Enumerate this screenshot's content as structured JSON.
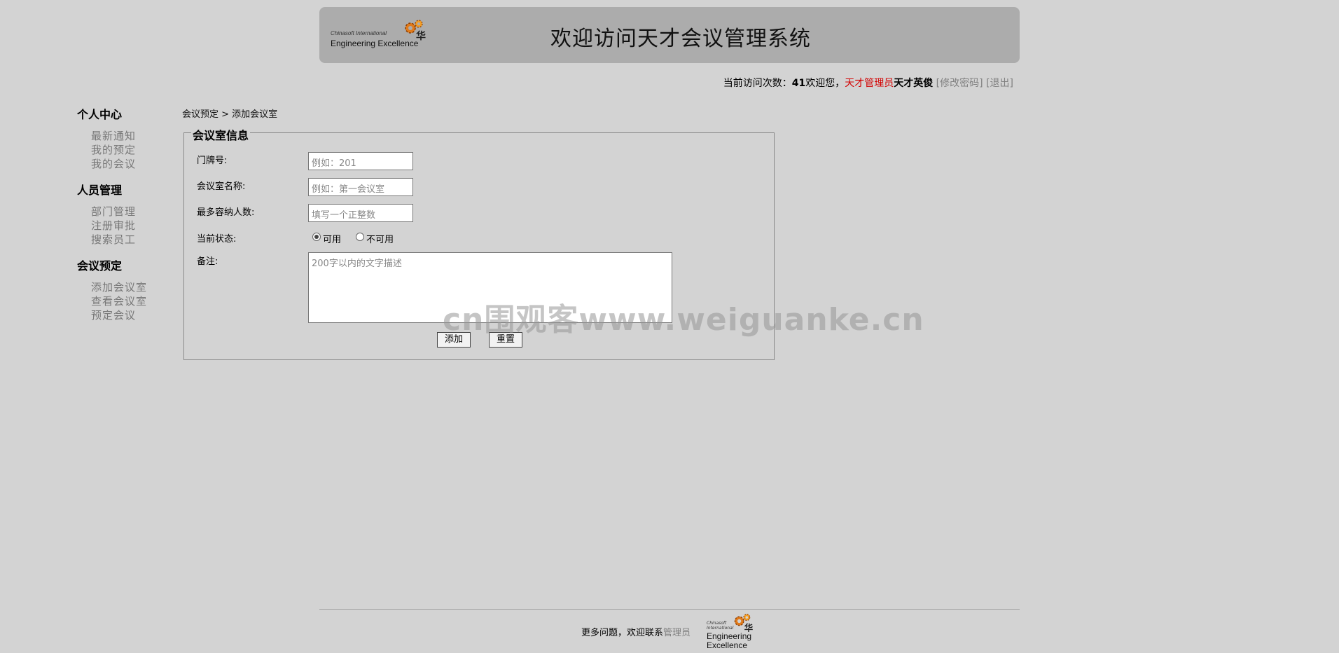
{
  "header": {
    "logo_line1": "Chinasoft International",
    "logo_line2": "Engineering Excellence",
    "title": "欢迎访问天才会议管理系统"
  },
  "userbar": {
    "visits_label": "当前访问次数：",
    "visits_count": "41",
    "welcome": "欢迎您，",
    "role": "天才管理员",
    "username": "天才英俊",
    "change_password": "[修改密码]",
    "logout": "[退出]"
  },
  "sidebar": {
    "groups": [
      {
        "title": "个人中心",
        "items": [
          "最新通知",
          "我的预定",
          "我的会议"
        ]
      },
      {
        "title": "人员管理",
        "items": [
          "部门管理",
          "注册审批",
          "搜索员工"
        ]
      },
      {
        "title": "会议预定",
        "items": [
          "添加会议室",
          "查看会议室",
          "预定会议"
        ]
      }
    ]
  },
  "breadcrumb": "会议预定 > 添加会议室",
  "form": {
    "legend": "会议室信息",
    "door_label": "门牌号:",
    "door_placeholder": "例如：201",
    "name_label": "会议室名称:",
    "name_placeholder": "例如：第一会议室",
    "capacity_label": "最多容纳人数:",
    "capacity_placeholder": "填写一个正整数",
    "status_label": "当前状态:",
    "status_options": [
      "可用",
      "不可用"
    ],
    "status_selected": "可用",
    "note_label": "备注:",
    "note_placeholder": "200字以内的文字描述",
    "add_button": "添加",
    "reset_button": "重置"
  },
  "footer": {
    "text": "更多问题，欢迎联系",
    "admin_link": "管理员",
    "logo_line1": "Chinasoft International",
    "logo_line2": "Engineering Excellence"
  },
  "watermark": "cn围观客www.weiguanke.cn",
  "colors": {
    "background": "#d3d3d3",
    "header": "#acacac",
    "role": "#d30000",
    "muted_link": "#808080"
  }
}
